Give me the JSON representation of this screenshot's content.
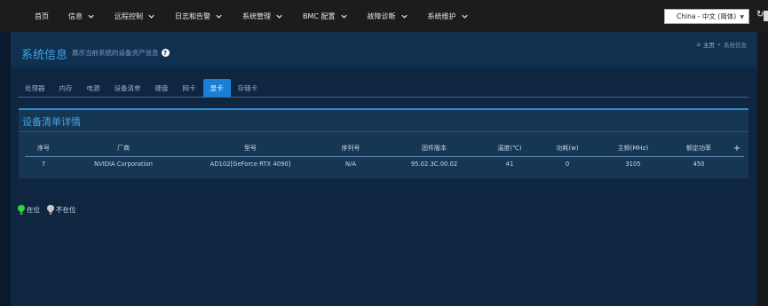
{
  "nav": {
    "items": [
      {
        "label": "首页",
        "has_menu": false
      },
      {
        "label": "信息",
        "has_menu": true
      },
      {
        "label": "远程控制",
        "has_menu": true
      },
      {
        "label": "日志和告警",
        "has_menu": true
      },
      {
        "label": "系统管理",
        "has_menu": true
      },
      {
        "label": "BMC 配置",
        "has_menu": true
      },
      {
        "label": "故障诊断",
        "has_menu": true
      },
      {
        "label": "系统维护",
        "has_menu": true
      }
    ],
    "language": "China - 中文 (简体)",
    "refresh_icon": "refresh-icon"
  },
  "header": {
    "title": "系统信息",
    "subtitle": "展示当前系统的设备资产信息",
    "breadcrumb": {
      "home": "主页",
      "separator": "»",
      "current": "系统信息"
    }
  },
  "tabs": [
    {
      "label": "处理器",
      "active": false
    },
    {
      "label": "内存",
      "active": false
    },
    {
      "label": "电源",
      "active": false
    },
    {
      "label": "设备清单",
      "active": false
    },
    {
      "label": "硬盘",
      "active": false
    },
    {
      "label": "网卡",
      "active": false
    },
    {
      "label": "显卡",
      "active": true
    },
    {
      "label": "存储卡",
      "active": false
    }
  ],
  "panel": {
    "title": "设备清单详情",
    "columns": [
      "序号",
      "厂商",
      "型号",
      "序列号",
      "固件版本",
      "温度(℃)",
      "功耗(w)",
      "主频(MHz)",
      "额定功率"
    ],
    "add_label": "+",
    "rows": [
      [
        "7",
        "NVIDIA Corporation",
        "AD102[GeForce RTX 4090]",
        "N/A",
        "95.02.3C.00.02",
        "41",
        "0",
        "3105",
        "450"
      ]
    ]
  },
  "legend": {
    "present": "在位",
    "absent": "不在位",
    "present_color": "#2fd33a",
    "absent_color": "#c8c8c8"
  }
}
